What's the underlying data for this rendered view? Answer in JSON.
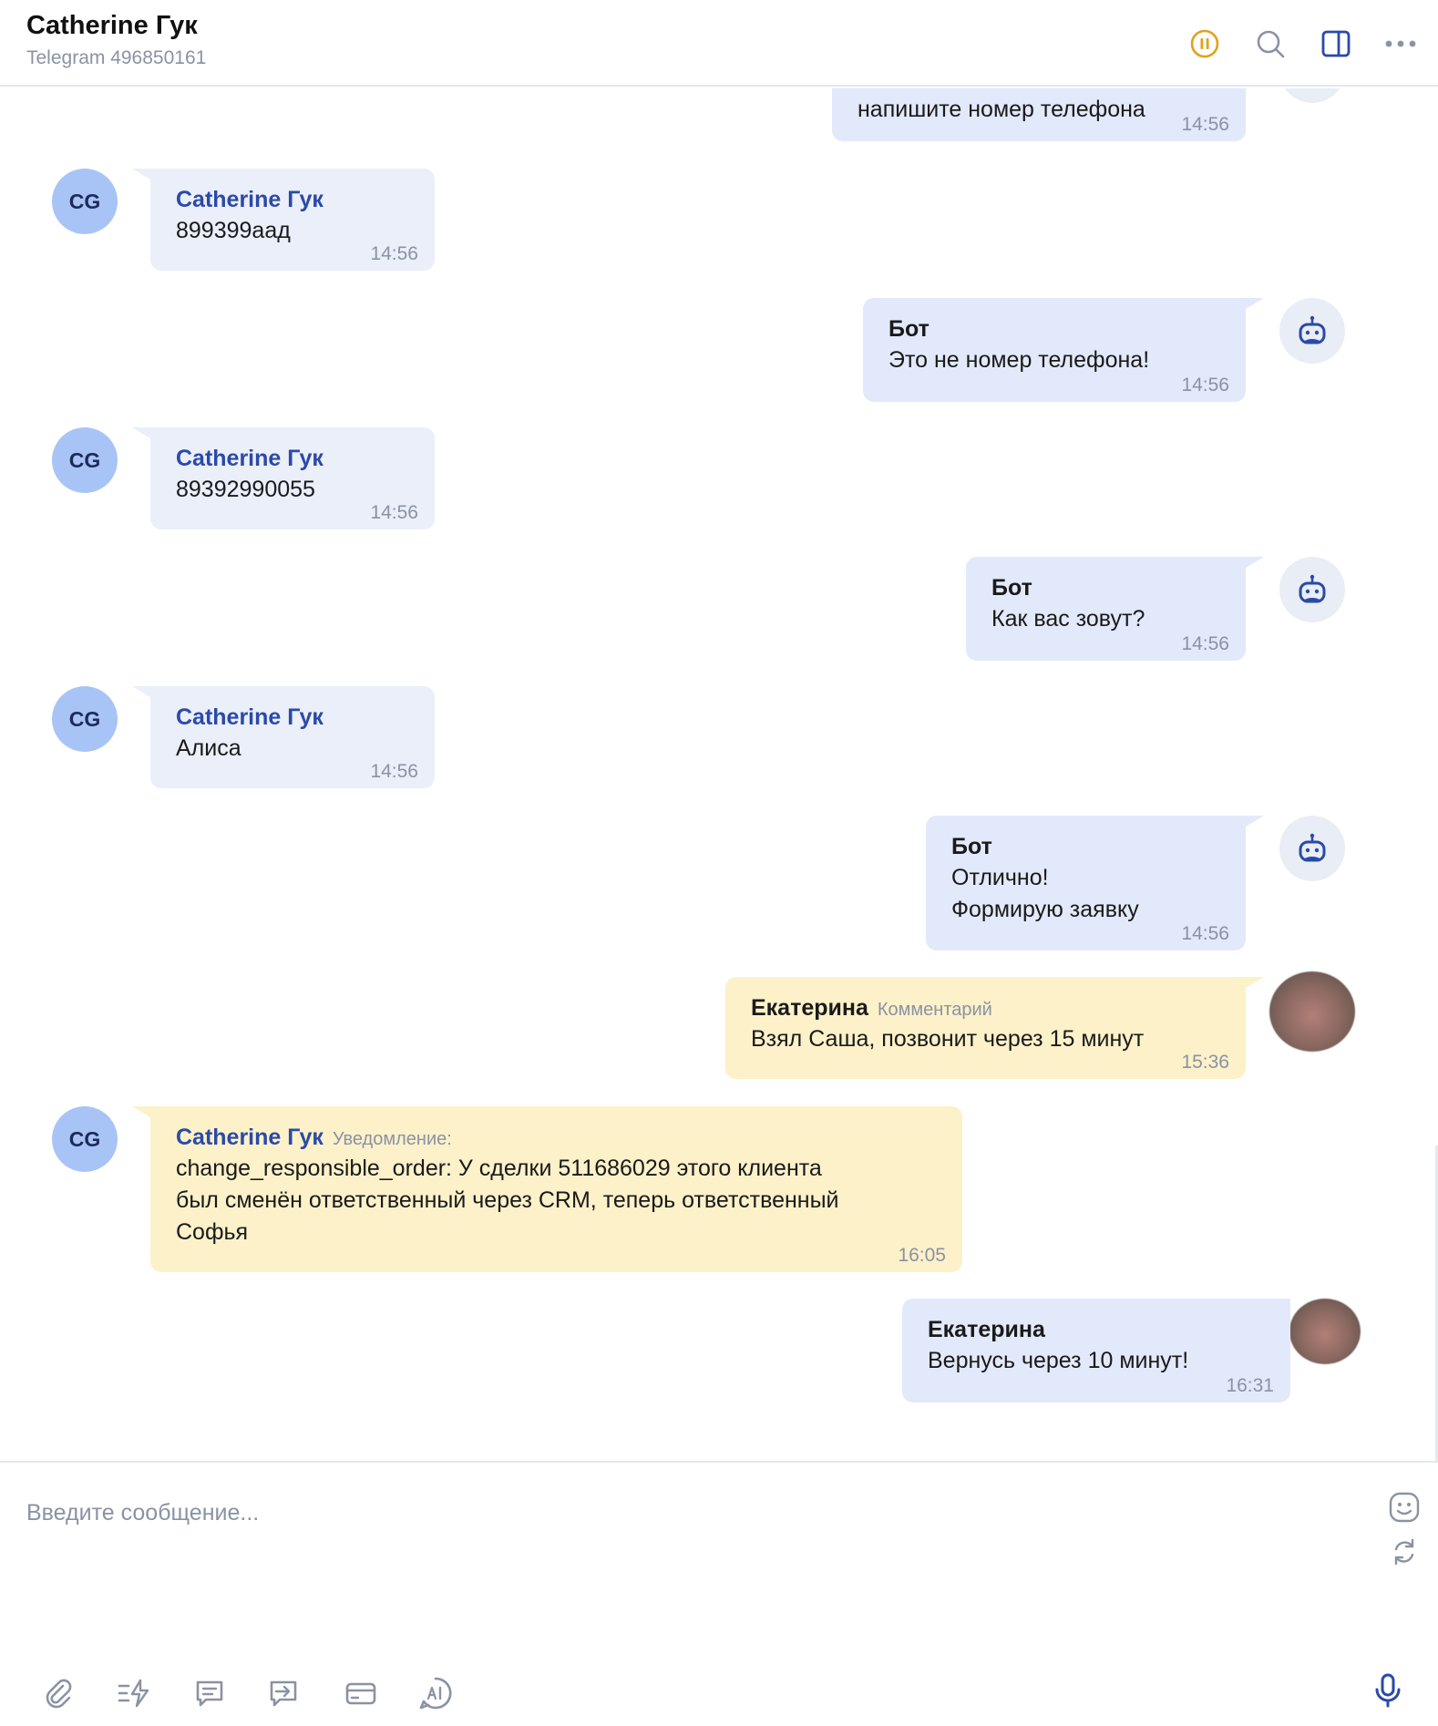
{
  "header": {
    "title": "Catherine Гук",
    "subtitle": "Telegram 496850161"
  },
  "messages": [
    {
      "kind": "bot",
      "text": "напишите номер телефона",
      "time": "14:56"
    },
    {
      "kind": "client",
      "avatar": "CG",
      "sender": "Catherine Гук",
      "text": "899399аад",
      "time": "14:56"
    },
    {
      "kind": "bot",
      "sender": "Бот",
      "text": "Это не номер телефона!",
      "time": "14:56"
    },
    {
      "kind": "client",
      "avatar": "CG",
      "sender": "Catherine Гук",
      "text": "89392990055",
      "time": "14:56"
    },
    {
      "kind": "bot",
      "sender": "Бот",
      "text": "Как вас зовут?",
      "time": "14:56"
    },
    {
      "kind": "client",
      "avatar": "CG",
      "sender": "Catherine Гук",
      "text": "Алиса",
      "time": "14:56"
    },
    {
      "kind": "bot",
      "sender": "Бот",
      "line1": "Отлично!",
      "line2": "Формирую заявку",
      "time": "14:56"
    },
    {
      "kind": "comment",
      "sender": "Екатерина",
      "tag": "Комментарий",
      "text": "Взял Саша, позвонит через 15 минут",
      "time": "15:36"
    },
    {
      "kind": "notification",
      "avatar": "CG",
      "sender": "Catherine Гук",
      "tag": "Уведомление:",
      "line1": "change_responsible_order: У сделки 511686029 этого клиента",
      "line2": "был сменён ответственный через CRM, теперь ответственный",
      "line3": "Софья",
      "time": "16:05"
    },
    {
      "kind": "operator",
      "sender": "Екатерина",
      "text": "Вернусь через 10 минут!",
      "time": "16:31"
    }
  ],
  "composer": {
    "placeholder": "Введите сообщение..."
  },
  "icons": {
    "header": [
      "pause-icon",
      "search-icon",
      "sidebar-panel-icon",
      "more-icon"
    ],
    "composer": [
      "paperclip-icon",
      "quick-replies-icon",
      "comment-icon",
      "forward-icon",
      "card-icon",
      "ai-icon",
      "emoji-icon",
      "switch-icon",
      "microphone-icon"
    ]
  },
  "colors": {
    "accent": "#2b4aa8",
    "client_bubble": "#ebeffa",
    "bot_bubble": "#e2e9fa",
    "note_bubble": "#fcf1c9",
    "avatar": "#a8c4f6",
    "pause": "#e0a11b"
  }
}
